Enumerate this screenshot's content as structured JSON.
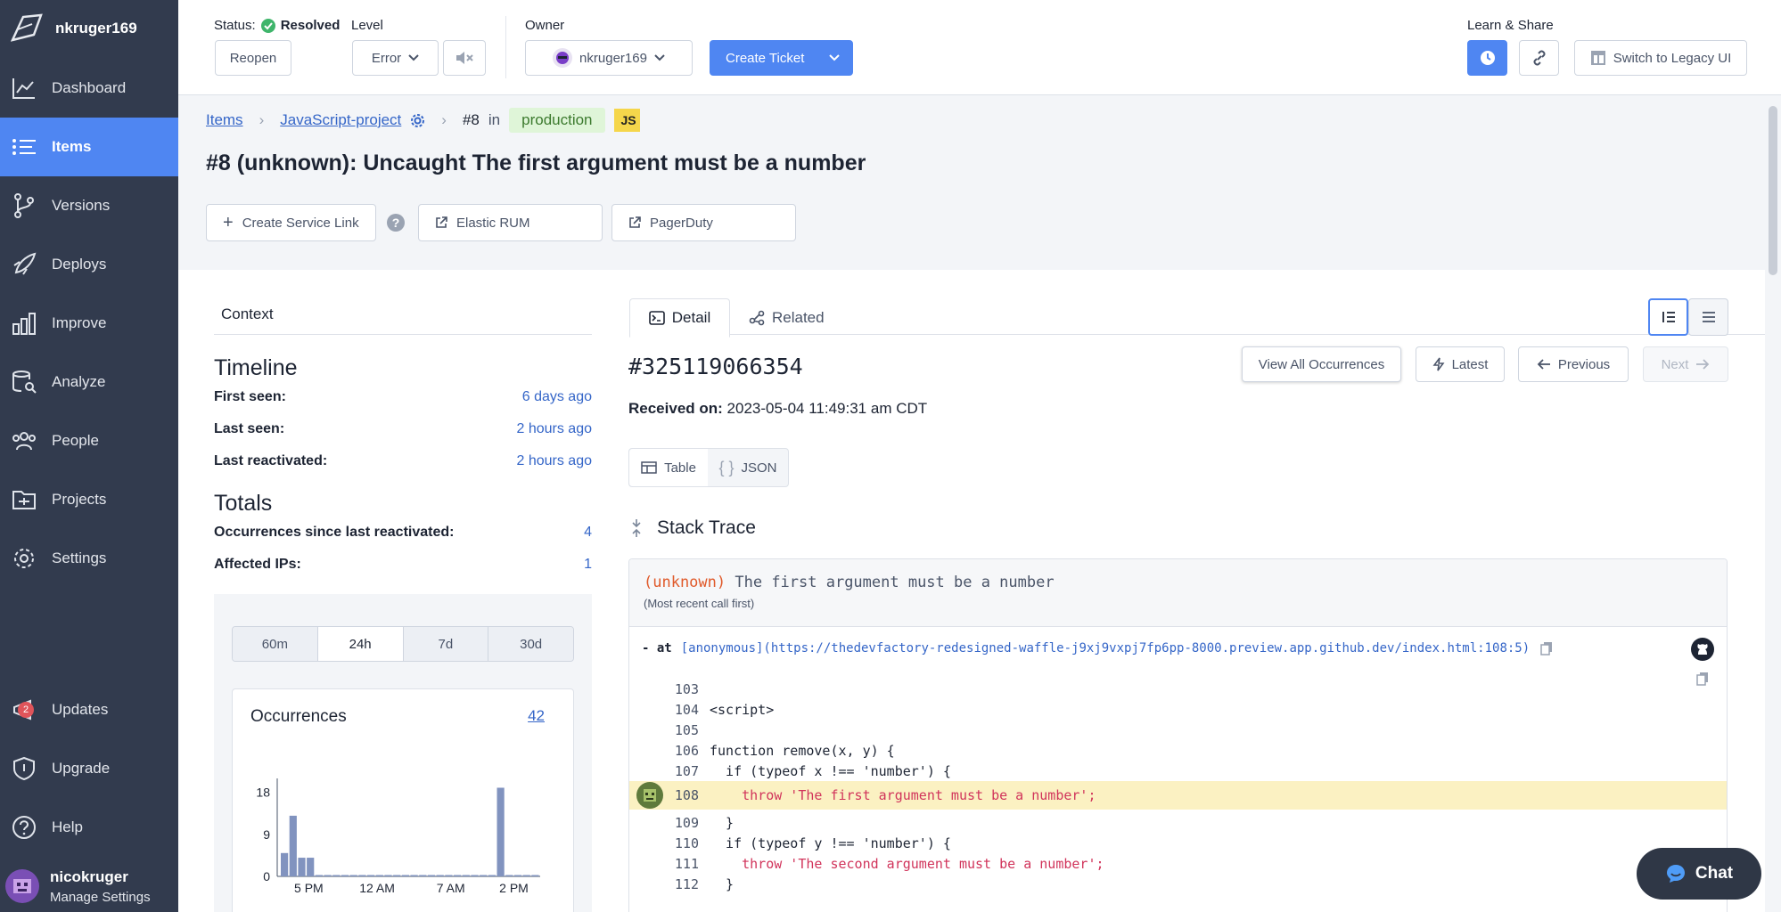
{
  "sidebar": {
    "account": "nkruger169",
    "items": [
      {
        "label": "Dashboard",
        "icon": "dashboard-icon"
      },
      {
        "label": "Items",
        "icon": "items-icon"
      },
      {
        "label": "Versions",
        "icon": "versions-icon"
      },
      {
        "label": "Deploys",
        "icon": "deploys-icon"
      },
      {
        "label": "Improve",
        "icon": "improve-icon"
      },
      {
        "label": "Analyze",
        "icon": "analyze-icon"
      },
      {
        "label": "People",
        "icon": "people-icon"
      },
      {
        "label": "Projects",
        "icon": "projects-icon"
      },
      {
        "label": "Settings",
        "icon": "settings-icon"
      }
    ],
    "bottom": [
      {
        "label": "Updates",
        "icon": "updates-icon",
        "badge": "2"
      },
      {
        "label": "Upgrade",
        "icon": "upgrade-icon"
      },
      {
        "label": "Help",
        "icon": "help-icon"
      }
    ],
    "user": {
      "name": "nicokruger",
      "sub": "Manage Settings"
    }
  },
  "topbar": {
    "status_label": "Status:",
    "status_value": "Resolved",
    "level_label": "Level",
    "reopen": "Reopen",
    "level_value": "Error",
    "owner_label": "Owner",
    "owner_value": "nkruger169",
    "create_ticket": "Create Ticket",
    "learn_label": "Learn & Share",
    "legacy": "Switch to Legacy UI"
  },
  "header": {
    "crumb_items": "Items",
    "crumb_project": "JavaScript-project",
    "crumb_number": "#8",
    "crumb_in": "in",
    "environment": "production",
    "lang": "JS",
    "title": "#8 (unknown): Uncaught The first argument must be a number",
    "buttons": {
      "service_link": "Create Service Link",
      "elastic": "Elastic RUM",
      "pagerduty": "PagerDuty"
    }
  },
  "context": {
    "title": "Context",
    "timeline": {
      "heading": "Timeline",
      "rows": [
        {
          "k": "First seen:",
          "v": "6 days ago"
        },
        {
          "k": "Last seen:",
          "v": "2 hours ago"
        },
        {
          "k": "Last reactivated:",
          "v": "2 hours ago"
        }
      ]
    },
    "totals": {
      "heading": "Totals",
      "rows": [
        {
          "k": "Occurrences since last reactivated:",
          "v": "4"
        },
        {
          "k": "Affected IPs:",
          "v": "1"
        }
      ]
    },
    "ranges": [
      "60m",
      "24h",
      "7d",
      "30d"
    ],
    "occurrences_label": "Occurrences",
    "occurrences_count": "42"
  },
  "chart_data": {
    "type": "bar",
    "title": "Occurrences",
    "yticks": [
      "18",
      "9",
      "0"
    ],
    "xticks": [
      "5 PM",
      "12 AM",
      "7 AM",
      "2 PM"
    ],
    "ylim": [
      0,
      21
    ],
    "values": [
      5,
      13,
      4,
      4,
      0,
      0,
      0,
      0,
      0,
      0,
      0,
      0,
      0,
      0,
      0,
      0,
      0,
      0,
      0,
      0,
      0,
      0,
      0,
      0,
      0,
      19,
      0,
      0,
      0,
      0
    ]
  },
  "detail": {
    "tab_detail": "Detail",
    "tab_related": "Related",
    "occurrence_id": "#325119066354",
    "received_label": "Received on:",
    "received_value": "2023-05-04 11:49:31 am CDT",
    "view_all": "View All Occurrences",
    "latest": "Latest",
    "previous": "Previous",
    "next": "Next",
    "view_table": "Table",
    "view_json": "JSON",
    "stack_trace": "Stack Trace",
    "error_type": "(unknown)",
    "error_msg": "The first argument must be a number",
    "recent_note": "(Most recent call first)",
    "frame_prefix": "- at",
    "frame": "[anonymous](https://thedevfactory-redesigned-waffle-j9xj9vxpj7fp6pp-8000.preview.app.github.dev/index.html:108:5)"
  },
  "code": [
    {
      "n": "103",
      "text": ""
    },
    {
      "n": "104",
      "text": "<script>"
    },
    {
      "n": "105",
      "text": ""
    },
    {
      "n": "106",
      "text": "function remove(x, y) {"
    },
    {
      "n": "107",
      "text": "  if (typeof x !== 'number') {"
    },
    {
      "n": "108",
      "text": "    throw 'The first argument must be a number';"
    },
    {
      "n": "109",
      "text": "  }"
    },
    {
      "n": "110",
      "text": "  if (typeof y !== 'number') {"
    },
    {
      "n": "111",
      "text": "    throw 'The second argument must be a number';"
    },
    {
      "n": "112",
      "text": "  }"
    }
  ],
  "chat": "Chat",
  "colors": {
    "sidebar": "#323b4e",
    "accent": "#4f86f2",
    "highlight": "#fbf1c2",
    "env_tag": "#dff5d8"
  }
}
